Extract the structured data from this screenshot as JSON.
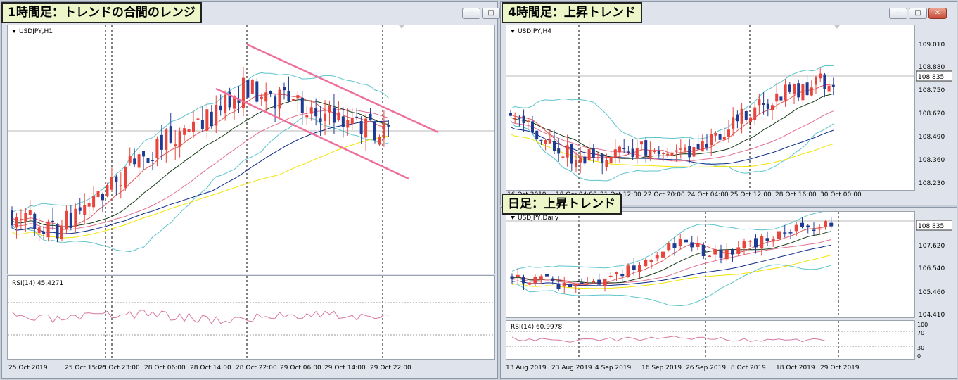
{
  "windows": [
    {
      "caption": "1時間足：トレンドの合間のレンジ",
      "symbol": "USDJPY,H1",
      "rsi_label": "RSI(14) 45.4271",
      "time_labels": [
        "25 Oct 2019",
        "25 Oct 15:00",
        "25 Oct 23:00",
        "28 Oct 06:00",
        "28 Oct 14:00",
        "28 Oct 22:00",
        "29 Oct 06:00",
        "29 Oct 14:00",
        "29 Oct 22:00"
      ],
      "price_labels": [],
      "current_price": ""
    },
    {
      "caption": "4時間足：上昇トレンド",
      "symbol": "USDJPY,H4",
      "rsi_label": "",
      "time_labels": [
        "16 Oct 2019",
        "18 Oct 04:00",
        "21 Oct 12:00",
        "22 Oct 20:00",
        "24 Oct 04:00",
        "25 Oct 12:00",
        "28 Oct 16:00",
        "30 Oct 00:00"
      ],
      "price_labels": [
        "109.010",
        "108.880",
        "108.750",
        "108.620",
        "108.490",
        "108.360",
        "108.230"
      ],
      "current_price": "108.835"
    },
    {
      "caption": "日足：上昇トレンド",
      "symbol": "USDJPY,Daily",
      "rsi_label": "RSI(14) 60.9978",
      "time_labels": [
        "13 Aug 2019",
        "23 Aug 2019",
        "4 Sep 2019",
        "16 Sep 2019",
        "26 Sep 2019",
        "8 Oct 2019",
        "18 Oct 2019",
        "29 Oct 2019"
      ],
      "price_labels": [
        "107.620",
        "106.540",
        "105.460",
        "104.410"
      ],
      "current_price": "108.835",
      "rsi_levels": [
        "100",
        "70",
        "30",
        "0"
      ]
    }
  ],
  "colors": {
    "bull": "#e8453c",
    "bear": "#1f3a93",
    "trendline": "#ef6f9b",
    "rsi": "#d5779f"
  },
  "window_buttons": {
    "minimize": "–",
    "maximize": "□",
    "close": "✕"
  },
  "chart_data": [
    {
      "type": "candlestick",
      "title": "USDJPY,H1",
      "trend_channel": "descending",
      "indicator": "RSI(14)",
      "rsi_value": 45.4271
    },
    {
      "type": "candlestick",
      "title": "USDJPY,H4",
      "ylim": [
        108.23,
        109.08
      ],
      "last_price": 108.835,
      "trend": "up"
    },
    {
      "type": "candlestick",
      "title": "USDJPY,Daily",
      "ylim": [
        104.41,
        109.0
      ],
      "last_price": 108.835,
      "trend": "up",
      "indicator": "RSI(14)",
      "rsi_value": 60.9978
    }
  ]
}
